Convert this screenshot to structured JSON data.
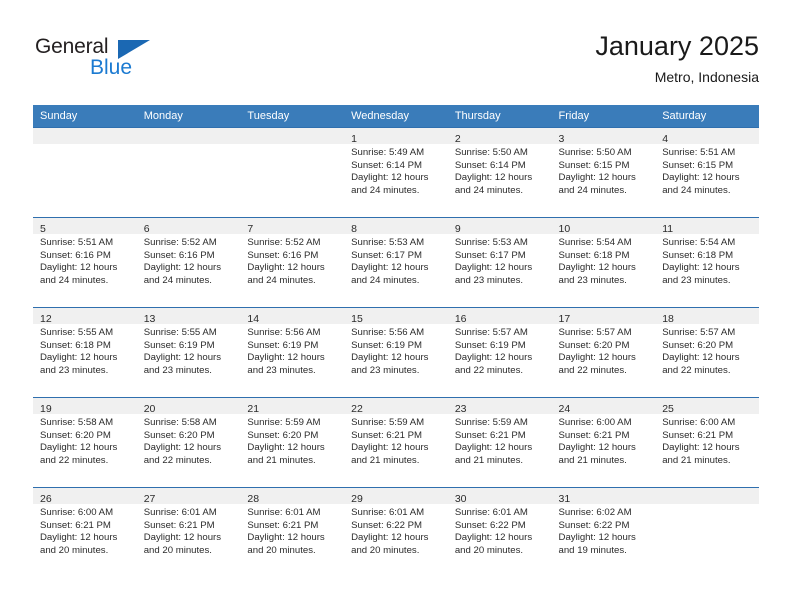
{
  "brand": {
    "name_part1": "General",
    "name_part2": "Blue",
    "triangle_color": "#1b68b3",
    "blue_color": "#1b7ad1"
  },
  "header": {
    "title": "January 2025",
    "subtitle": "Metro, Indonesia"
  },
  "theme": {
    "header_row_bg": "#3a7cba",
    "header_row_text": "#ffffff",
    "date_band_bg": "#f0f0f0",
    "week_separator": "#2f6fae",
    "body_text": "#2b2b2b"
  },
  "weekday_headers": [
    "Sunday",
    "Monday",
    "Tuesday",
    "Wednesday",
    "Thursday",
    "Friday",
    "Saturday"
  ],
  "labels": {
    "sunrise": "Sunrise:",
    "sunset": "Sunset:",
    "daylight": "Daylight:"
  },
  "weeks": [
    [
      {
        "day": "",
        "empty": true
      },
      {
        "day": "",
        "empty": true
      },
      {
        "day": "",
        "empty": true
      },
      {
        "day": "1",
        "sunrise": "Sunrise: 5:49 AM",
        "sunset": "Sunset: 6:14 PM",
        "daylight_line1": "Daylight: 12 hours",
        "daylight_line2": "and 24 minutes."
      },
      {
        "day": "2",
        "sunrise": "Sunrise: 5:50 AM",
        "sunset": "Sunset: 6:14 PM",
        "daylight_line1": "Daylight: 12 hours",
        "daylight_line2": "and 24 minutes."
      },
      {
        "day": "3",
        "sunrise": "Sunrise: 5:50 AM",
        "sunset": "Sunset: 6:15 PM",
        "daylight_line1": "Daylight: 12 hours",
        "daylight_line2": "and 24 minutes."
      },
      {
        "day": "4",
        "sunrise": "Sunrise: 5:51 AM",
        "sunset": "Sunset: 6:15 PM",
        "daylight_line1": "Daylight: 12 hours",
        "daylight_line2": "and 24 minutes."
      }
    ],
    [
      {
        "day": "5",
        "sunrise": "Sunrise: 5:51 AM",
        "sunset": "Sunset: 6:16 PM",
        "daylight_line1": "Daylight: 12 hours",
        "daylight_line2": "and 24 minutes."
      },
      {
        "day": "6",
        "sunrise": "Sunrise: 5:52 AM",
        "sunset": "Sunset: 6:16 PM",
        "daylight_line1": "Daylight: 12 hours",
        "daylight_line2": "and 24 minutes."
      },
      {
        "day": "7",
        "sunrise": "Sunrise: 5:52 AM",
        "sunset": "Sunset: 6:16 PM",
        "daylight_line1": "Daylight: 12 hours",
        "daylight_line2": "and 24 minutes."
      },
      {
        "day": "8",
        "sunrise": "Sunrise: 5:53 AM",
        "sunset": "Sunset: 6:17 PM",
        "daylight_line1": "Daylight: 12 hours",
        "daylight_line2": "and 24 minutes."
      },
      {
        "day": "9",
        "sunrise": "Sunrise: 5:53 AM",
        "sunset": "Sunset: 6:17 PM",
        "daylight_line1": "Daylight: 12 hours",
        "daylight_line2": "and 23 minutes."
      },
      {
        "day": "10",
        "sunrise": "Sunrise: 5:54 AM",
        "sunset": "Sunset: 6:18 PM",
        "daylight_line1": "Daylight: 12 hours",
        "daylight_line2": "and 23 minutes."
      },
      {
        "day": "11",
        "sunrise": "Sunrise: 5:54 AM",
        "sunset": "Sunset: 6:18 PM",
        "daylight_line1": "Daylight: 12 hours",
        "daylight_line2": "and 23 minutes."
      }
    ],
    [
      {
        "day": "12",
        "sunrise": "Sunrise: 5:55 AM",
        "sunset": "Sunset: 6:18 PM",
        "daylight_line1": "Daylight: 12 hours",
        "daylight_line2": "and 23 minutes."
      },
      {
        "day": "13",
        "sunrise": "Sunrise: 5:55 AM",
        "sunset": "Sunset: 6:19 PM",
        "daylight_line1": "Daylight: 12 hours",
        "daylight_line2": "and 23 minutes."
      },
      {
        "day": "14",
        "sunrise": "Sunrise: 5:56 AM",
        "sunset": "Sunset: 6:19 PM",
        "daylight_line1": "Daylight: 12 hours",
        "daylight_line2": "and 23 minutes."
      },
      {
        "day": "15",
        "sunrise": "Sunrise: 5:56 AM",
        "sunset": "Sunset: 6:19 PM",
        "daylight_line1": "Daylight: 12 hours",
        "daylight_line2": "and 23 minutes."
      },
      {
        "day": "16",
        "sunrise": "Sunrise: 5:57 AM",
        "sunset": "Sunset: 6:19 PM",
        "daylight_line1": "Daylight: 12 hours",
        "daylight_line2": "and 22 minutes."
      },
      {
        "day": "17",
        "sunrise": "Sunrise: 5:57 AM",
        "sunset": "Sunset: 6:20 PM",
        "daylight_line1": "Daylight: 12 hours",
        "daylight_line2": "and 22 minutes."
      },
      {
        "day": "18",
        "sunrise": "Sunrise: 5:57 AM",
        "sunset": "Sunset: 6:20 PM",
        "daylight_line1": "Daylight: 12 hours",
        "daylight_line2": "and 22 minutes."
      }
    ],
    [
      {
        "day": "19",
        "sunrise": "Sunrise: 5:58 AM",
        "sunset": "Sunset: 6:20 PM",
        "daylight_line1": "Daylight: 12 hours",
        "daylight_line2": "and 22 minutes."
      },
      {
        "day": "20",
        "sunrise": "Sunrise: 5:58 AM",
        "sunset": "Sunset: 6:20 PM",
        "daylight_line1": "Daylight: 12 hours",
        "daylight_line2": "and 22 minutes."
      },
      {
        "day": "21",
        "sunrise": "Sunrise: 5:59 AM",
        "sunset": "Sunset: 6:20 PM",
        "daylight_line1": "Daylight: 12 hours",
        "daylight_line2": "and 21 minutes."
      },
      {
        "day": "22",
        "sunrise": "Sunrise: 5:59 AM",
        "sunset": "Sunset: 6:21 PM",
        "daylight_line1": "Daylight: 12 hours",
        "daylight_line2": "and 21 minutes."
      },
      {
        "day": "23",
        "sunrise": "Sunrise: 5:59 AM",
        "sunset": "Sunset: 6:21 PM",
        "daylight_line1": "Daylight: 12 hours",
        "daylight_line2": "and 21 minutes."
      },
      {
        "day": "24",
        "sunrise": "Sunrise: 6:00 AM",
        "sunset": "Sunset: 6:21 PM",
        "daylight_line1": "Daylight: 12 hours",
        "daylight_line2": "and 21 minutes."
      },
      {
        "day": "25",
        "sunrise": "Sunrise: 6:00 AM",
        "sunset": "Sunset: 6:21 PM",
        "daylight_line1": "Daylight: 12 hours",
        "daylight_line2": "and 21 minutes."
      }
    ],
    [
      {
        "day": "26",
        "sunrise": "Sunrise: 6:00 AM",
        "sunset": "Sunset: 6:21 PM",
        "daylight_line1": "Daylight: 12 hours",
        "daylight_line2": "and 20 minutes."
      },
      {
        "day": "27",
        "sunrise": "Sunrise: 6:01 AM",
        "sunset": "Sunset: 6:21 PM",
        "daylight_line1": "Daylight: 12 hours",
        "daylight_line2": "and 20 minutes."
      },
      {
        "day": "28",
        "sunrise": "Sunrise: 6:01 AM",
        "sunset": "Sunset: 6:21 PM",
        "daylight_line1": "Daylight: 12 hours",
        "daylight_line2": "and 20 minutes."
      },
      {
        "day": "29",
        "sunrise": "Sunrise: 6:01 AM",
        "sunset": "Sunset: 6:22 PM",
        "daylight_line1": "Daylight: 12 hours",
        "daylight_line2": "and 20 minutes."
      },
      {
        "day": "30",
        "sunrise": "Sunrise: 6:01 AM",
        "sunset": "Sunset: 6:22 PM",
        "daylight_line1": "Daylight: 12 hours",
        "daylight_line2": "and 20 minutes."
      },
      {
        "day": "31",
        "sunrise": "Sunrise: 6:02 AM",
        "sunset": "Sunset: 6:22 PM",
        "daylight_line1": "Daylight: 12 hours",
        "daylight_line2": "and 19 minutes."
      },
      {
        "day": "",
        "empty": true
      }
    ]
  ]
}
